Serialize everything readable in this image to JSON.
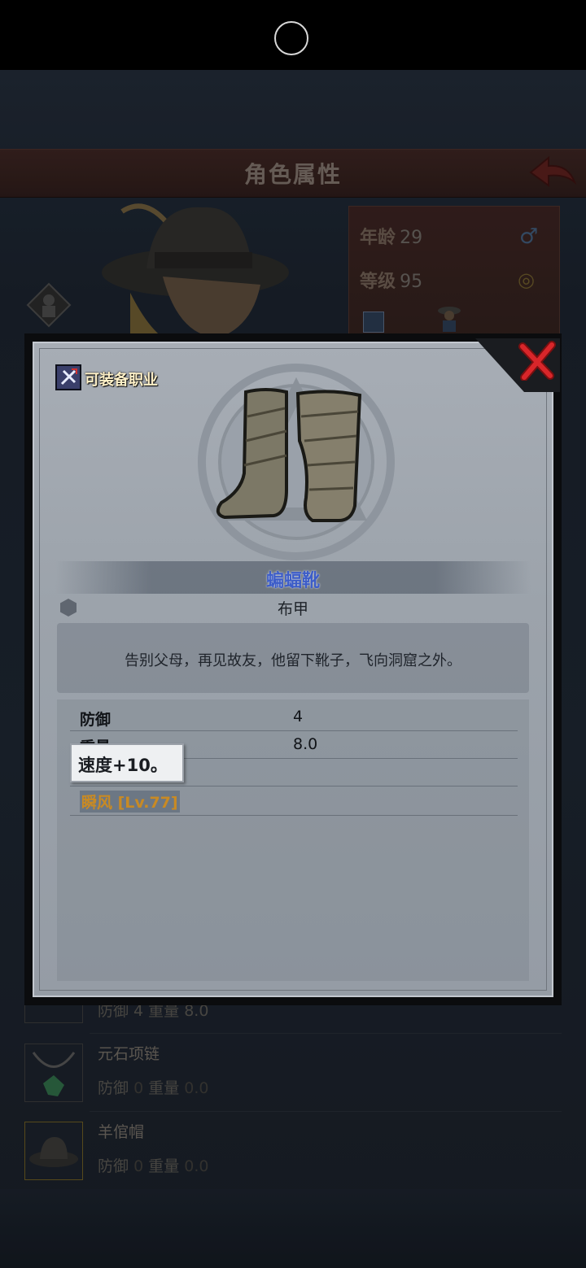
{
  "background": {
    "title": "角色属性",
    "info": {
      "age_label": "年龄",
      "age_value": "29",
      "level_label": "等级",
      "level_value": "95"
    },
    "list": [
      {
        "name": "",
        "stats": "防御 4 重量 8.0"
      },
      {
        "name": "元石项链",
        "def_label": "防御",
        "def_value": "0",
        "weight_label": "重量",
        "weight_value": "0.0"
      },
      {
        "name": "羊倌帽",
        "def_label": "防御",
        "def_value": "0",
        "weight_label": "重量",
        "weight_value": "0.0"
      }
    ]
  },
  "modal": {
    "equip_class_label": "可装备职业",
    "item_name": "蝙蝠靴",
    "item_type": "布甲",
    "description": "告别父母，再见故友，他留下靴子，飞向洞窟之外。",
    "stats": [
      {
        "label": "防御",
        "value": "4"
      },
      {
        "label": "重量",
        "value": "8.0"
      }
    ],
    "skill": "瞬风 [Lv.77]",
    "tooltip": "速度+10。"
  },
  "colors": {
    "item_name": "#3d5dc8",
    "skill": "#c88a24",
    "close": "#d8262a"
  },
  "icons": [
    "notch-circle",
    "back-arrow-icon",
    "close-icon",
    "equip-class-icon",
    "hex-icon",
    "gender-male-icon",
    "ring-icon",
    "boots-image"
  ]
}
